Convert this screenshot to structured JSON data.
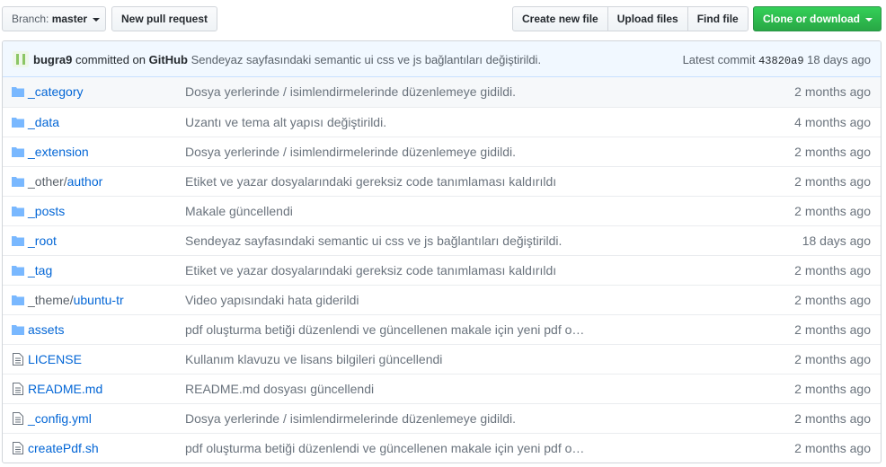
{
  "toolbar": {
    "branch_label": "Branch:",
    "branch_name": "master",
    "new_pr": "New pull request",
    "create_file": "Create new file",
    "upload_files": "Upload files",
    "find_file": "Find file",
    "clone": "Clone or download"
  },
  "commit": {
    "author": "bugra9",
    "committed_on": "committed on",
    "platform": "GitHub",
    "message": "Sendeyaz sayfasındaki semantic ui css ve js bağlantıları değiştirildi.",
    "latest_label": "Latest commit",
    "sha": "43820a9",
    "age": "18 days ago"
  },
  "files": [
    {
      "type": "dir",
      "name": "_category",
      "message": "Dosya yerlerinde / isimlendirmelerinde düzenlemeye gidildi.",
      "age": "2 months ago"
    },
    {
      "type": "dir",
      "name": "_data",
      "message": "Uzantı ve tema alt yapısı değiştirildi.",
      "age": "4 months ago"
    },
    {
      "type": "dir",
      "name": "_extension",
      "message": "Dosya yerlerinde / isimlendirmelerinde düzenlemeye gidildi.",
      "age": "2 months ago"
    },
    {
      "type": "dir",
      "prefix": "_other/",
      "name": "author",
      "message": "Etiket ve yazar dosyalarındaki gereksiz code tanımlaması kaldırıldı",
      "age": "2 months ago"
    },
    {
      "type": "dir",
      "name": "_posts",
      "message": "Makale güncellendi",
      "age": "2 months ago"
    },
    {
      "type": "dir",
      "name": "_root",
      "message": "Sendeyaz sayfasındaki semantic ui css ve js bağlantıları değiştirildi.",
      "age": "18 days ago"
    },
    {
      "type": "dir",
      "name": "_tag",
      "message": "Etiket ve yazar dosyalarındaki gereksiz code tanımlaması kaldırıldı",
      "age": "2 months ago"
    },
    {
      "type": "dir",
      "prefix": "_theme/",
      "name": "ubuntu-tr",
      "message": "Video yapısındaki hata giderildi",
      "age": "2 months ago"
    },
    {
      "type": "dir",
      "name": "assets",
      "message": "pdf oluşturma betiği düzenlendi ve güncellenen makale için yeni pdf o…",
      "age": "2 months ago"
    },
    {
      "type": "file",
      "name": "LICENSE",
      "message": "Kullanım klavuzu ve lisans bilgileri güncellendi",
      "age": "2 months ago"
    },
    {
      "type": "file",
      "name": "README.md",
      "message": "README.md dosyası güncellendi",
      "age": "2 months ago"
    },
    {
      "type": "file",
      "name": "_config.yml",
      "message": "Dosya yerlerinde / isimlendirmelerinde düzenlemeye gidildi.",
      "age": "2 months ago"
    },
    {
      "type": "file",
      "name": "createPdf.sh",
      "message": "pdf oluşturma betiği düzenlendi ve güncellenen makale için yeni pdf o…",
      "age": "2 months ago"
    }
  ],
  "colors": {
    "folder": "#79b8ff",
    "link": "#0366d6",
    "clone_bg": "#28a745"
  }
}
